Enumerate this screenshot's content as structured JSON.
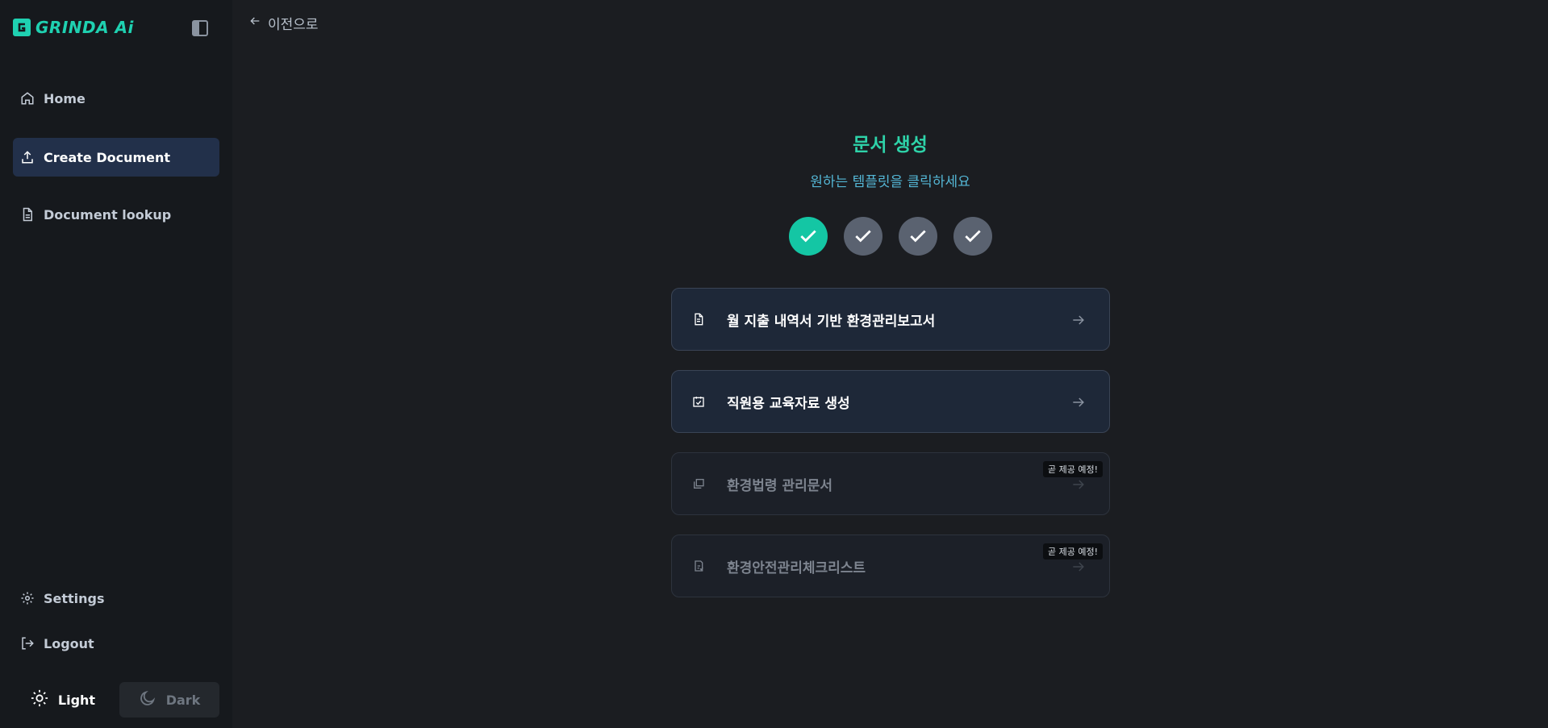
{
  "app": {
    "name": "GRINDA Ai"
  },
  "sidebar": {
    "items": [
      {
        "label": "Home",
        "icon": "home-icon",
        "active": false
      },
      {
        "label": "Create Document",
        "icon": "upload-icon",
        "active": true
      },
      {
        "label": "Document lookup",
        "icon": "document-icon",
        "active": false
      }
    ],
    "bottom_items": [
      {
        "label": "Settings",
        "icon": "gear-icon"
      },
      {
        "label": "Logout",
        "icon": "logout-icon"
      }
    ],
    "theme": {
      "light_label": "Light",
      "dark_label": "Dark",
      "selected": "Light"
    }
  },
  "header": {
    "back_label": "이전으로"
  },
  "main": {
    "title": "문서 생성",
    "subtitle": "원하는 템플릿을 클릭하세요",
    "steps": [
      {
        "state": "done"
      },
      {
        "state": "pending"
      },
      {
        "state": "pending"
      },
      {
        "state": "pending"
      }
    ],
    "templates": [
      {
        "label": "월 지출 내역서 기반 환경관리보고서",
        "icon": "file-text-icon",
        "enabled": true,
        "badge": ""
      },
      {
        "label": "직원용 교육자료 생성",
        "icon": "calendar-check-icon",
        "enabled": true,
        "badge": ""
      },
      {
        "label": "환경법령 관리문서",
        "icon": "copy-icon",
        "enabled": false,
        "badge": "곧 제공 예정!"
      },
      {
        "label": "환경안전관리체크리스트",
        "icon": "clipboard-icon",
        "enabled": false,
        "badge": "곧 제공 예정!"
      }
    ]
  },
  "colors": {
    "accent": "#14c6a4",
    "title": "#2ed3a9",
    "subtitle": "#54b7d6",
    "active_nav": "#22304a"
  }
}
